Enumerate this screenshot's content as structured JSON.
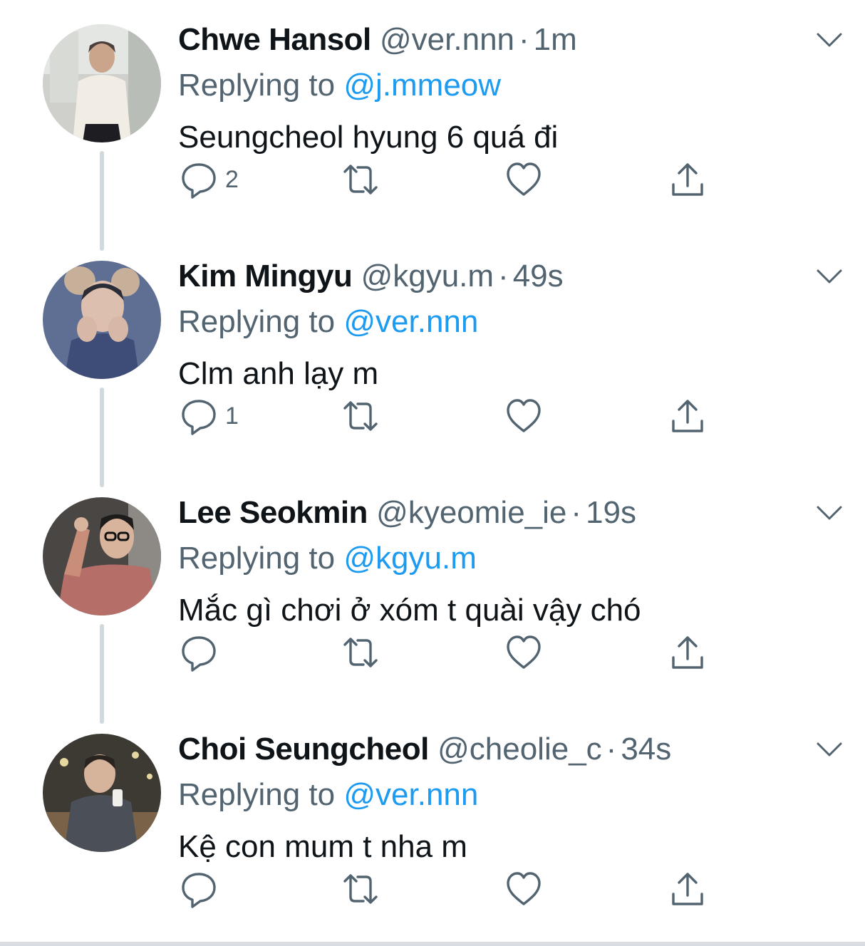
{
  "tweets": [
    {
      "name": "Chwe Hansol",
      "handle": "@ver.nnn",
      "dot": "·",
      "time": "1m",
      "replying_prefix": "Replying to ",
      "replying_to": "@j.mmeow",
      "text": "Seungcheol hyung 6 quá đi",
      "reply_count": "2",
      "avatar": "avatar-photo"
    },
    {
      "name": "Kim Mingyu",
      "handle": "@kgyu.m",
      "dot": "·",
      "time": "49s",
      "replying_prefix": "Replying to ",
      "replying_to": "@ver.nnn",
      "text": "Clm anh lạy m",
      "reply_count": "1",
      "avatar": "avatar-photo"
    },
    {
      "name": "Lee Seokmin",
      "handle": "@kyeomie_ie",
      "dot": "·",
      "time": "19s",
      "replying_prefix": "Replying to ",
      "replying_to": "@kgyu.m",
      "text": "Mắc gì chơi ở xóm t quài vậy chó",
      "reply_count": "",
      "avatar": "avatar-photo"
    },
    {
      "name": "Choi Seungcheol",
      "handle": "@cheolie_c",
      "dot": "·",
      "time": "34s",
      "replying_prefix": "Replying to ",
      "replying_to": "@ver.nnn",
      "text": "Kệ con mum t nha m",
      "reply_count": "",
      "avatar": "avatar-photo"
    }
  ],
  "icons": {
    "reply": "reply-icon",
    "retweet": "retweet-icon",
    "like": "heart-icon",
    "share": "share-icon",
    "more": "chevron-down-icon"
  },
  "colors": {
    "text": "#0f1419",
    "secondary": "#536471",
    "link": "#1d9bf0",
    "thread_line": "#cfd9de"
  }
}
